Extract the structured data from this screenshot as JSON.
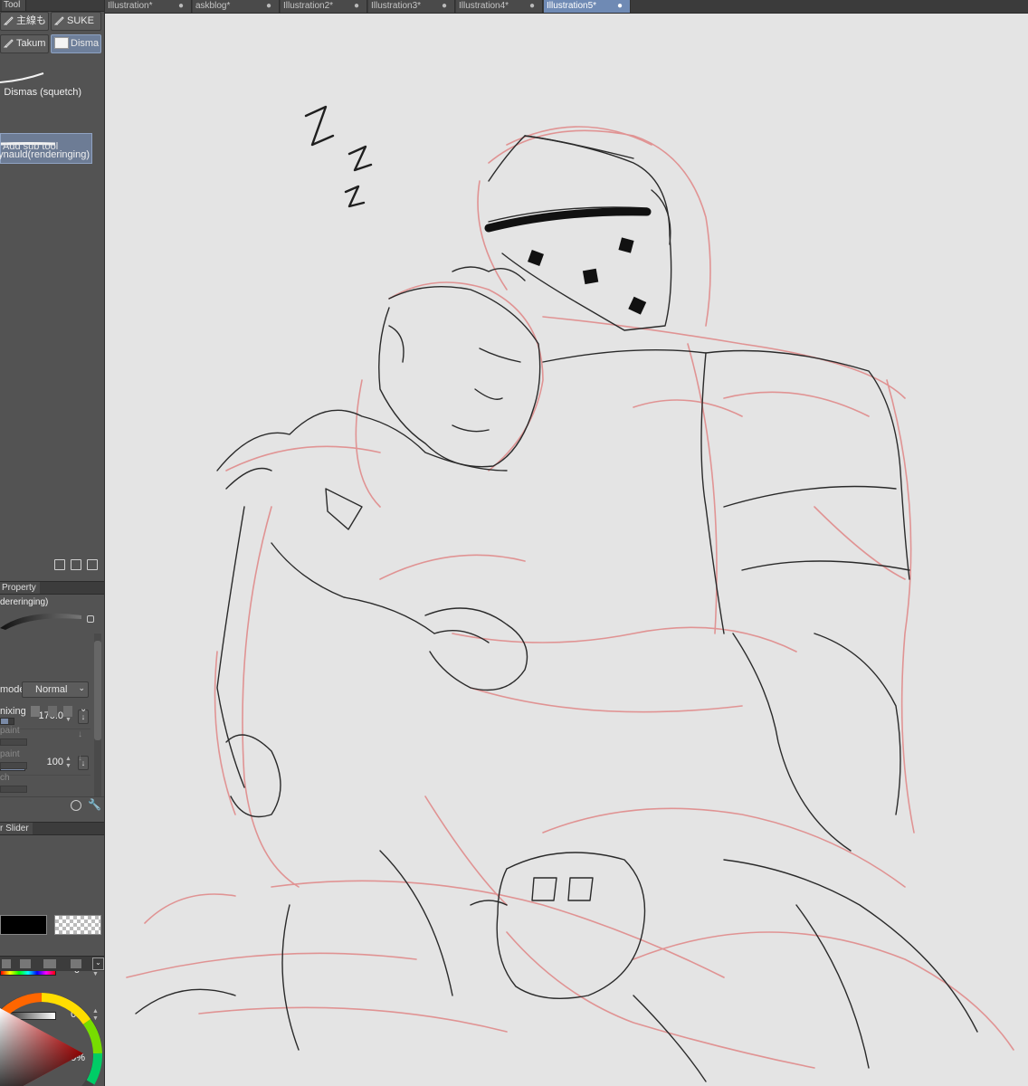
{
  "tool_panel": {
    "title": "Tool",
    "tool_buttons": [
      {
        "label": "主線も",
        "selected": false
      },
      {
        "label": "SUKE",
        "selected": false
      },
      {
        "label": "Takum",
        "selected": false
      },
      {
        "label": "Disma",
        "selected": true
      }
    ],
    "brushes": [
      {
        "label": "Dismas (squetch)",
        "selected": false
      },
      {
        "label": "eynauld(renderinging)",
        "selected": true
      }
    ],
    "add_sub_tool": "Add sub tool"
  },
  "property_panel": {
    "title": "Property",
    "tool_name": "dereringing)",
    "brush_size": "170.0",
    "opacity": "100",
    "blend_mode_label": "mode",
    "blend_mode_value": "Normal",
    "color_mixing_label": "nixing",
    "disabled_rows": [
      " paint",
      " paint",
      "ch"
    ]
  },
  "color_slider": {
    "title": "r Slider",
    "values": [
      "0",
      "0%",
      "0%"
    ],
    "main_color": "#000000"
  },
  "doc_tabs": [
    {
      "label": "Illustration*",
      "active": false
    },
    {
      "label": "askblog*",
      "active": false
    },
    {
      "label": "Illustration2*",
      "active": false
    },
    {
      "label": "Illustration3*",
      "active": false
    },
    {
      "label": "Illustration4*",
      "active": false
    },
    {
      "label": "Illustration5*",
      "active": true
    }
  ],
  "canvas": {
    "sleep_marks": [
      "Z",
      "Z",
      "Z"
    ]
  }
}
